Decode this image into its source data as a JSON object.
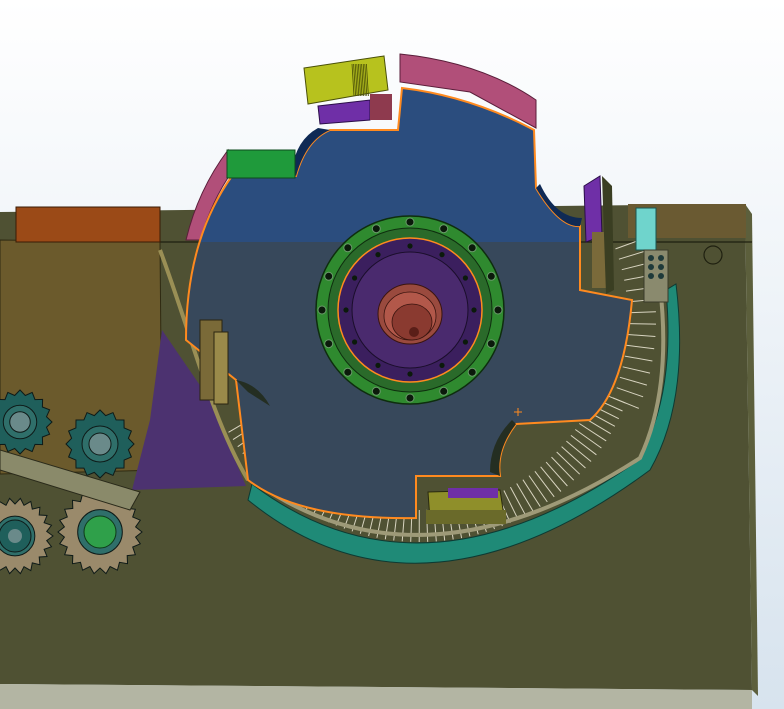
{
  "viewport": {
    "background_top": "#ffffff",
    "background_bottom": "#d7e3ee"
  },
  "colors": {
    "housing_body": "#4f5133",
    "housing_shadow": "#3f4128",
    "housing_side": "#5c5f3c",
    "base_floor": "#b3b5a3",
    "housing_cap": "#6a5a32",
    "left_cover": "#6b5a2c",
    "orange_block": "#9b4a17",
    "rotor_blue": "#2b4d7e",
    "rotor_lower_blue": "#37485b",
    "rotor_edge": "#ff8a1f",
    "maroon_segment": "#b14f79",
    "lime_block": "#b7c21e",
    "purple_block": "#6f2fa7",
    "green_block": "#1f9a3b",
    "teal_band": "#1f8a77",
    "hub_green": "#2f8a2f",
    "hub_purple": "#3b1f5e",
    "shaft_brown": "#9a4a3e",
    "gear_teal": "#1f5f5b",
    "gear_tan": "#9a8a6b",
    "purple_wedge": "#4c3270",
    "steel_grey": "#8a8a7a",
    "cyan_part": "#6fd4cc"
  },
  "icons": {
    "origin_marker": "plus-crosshair-icon"
  }
}
